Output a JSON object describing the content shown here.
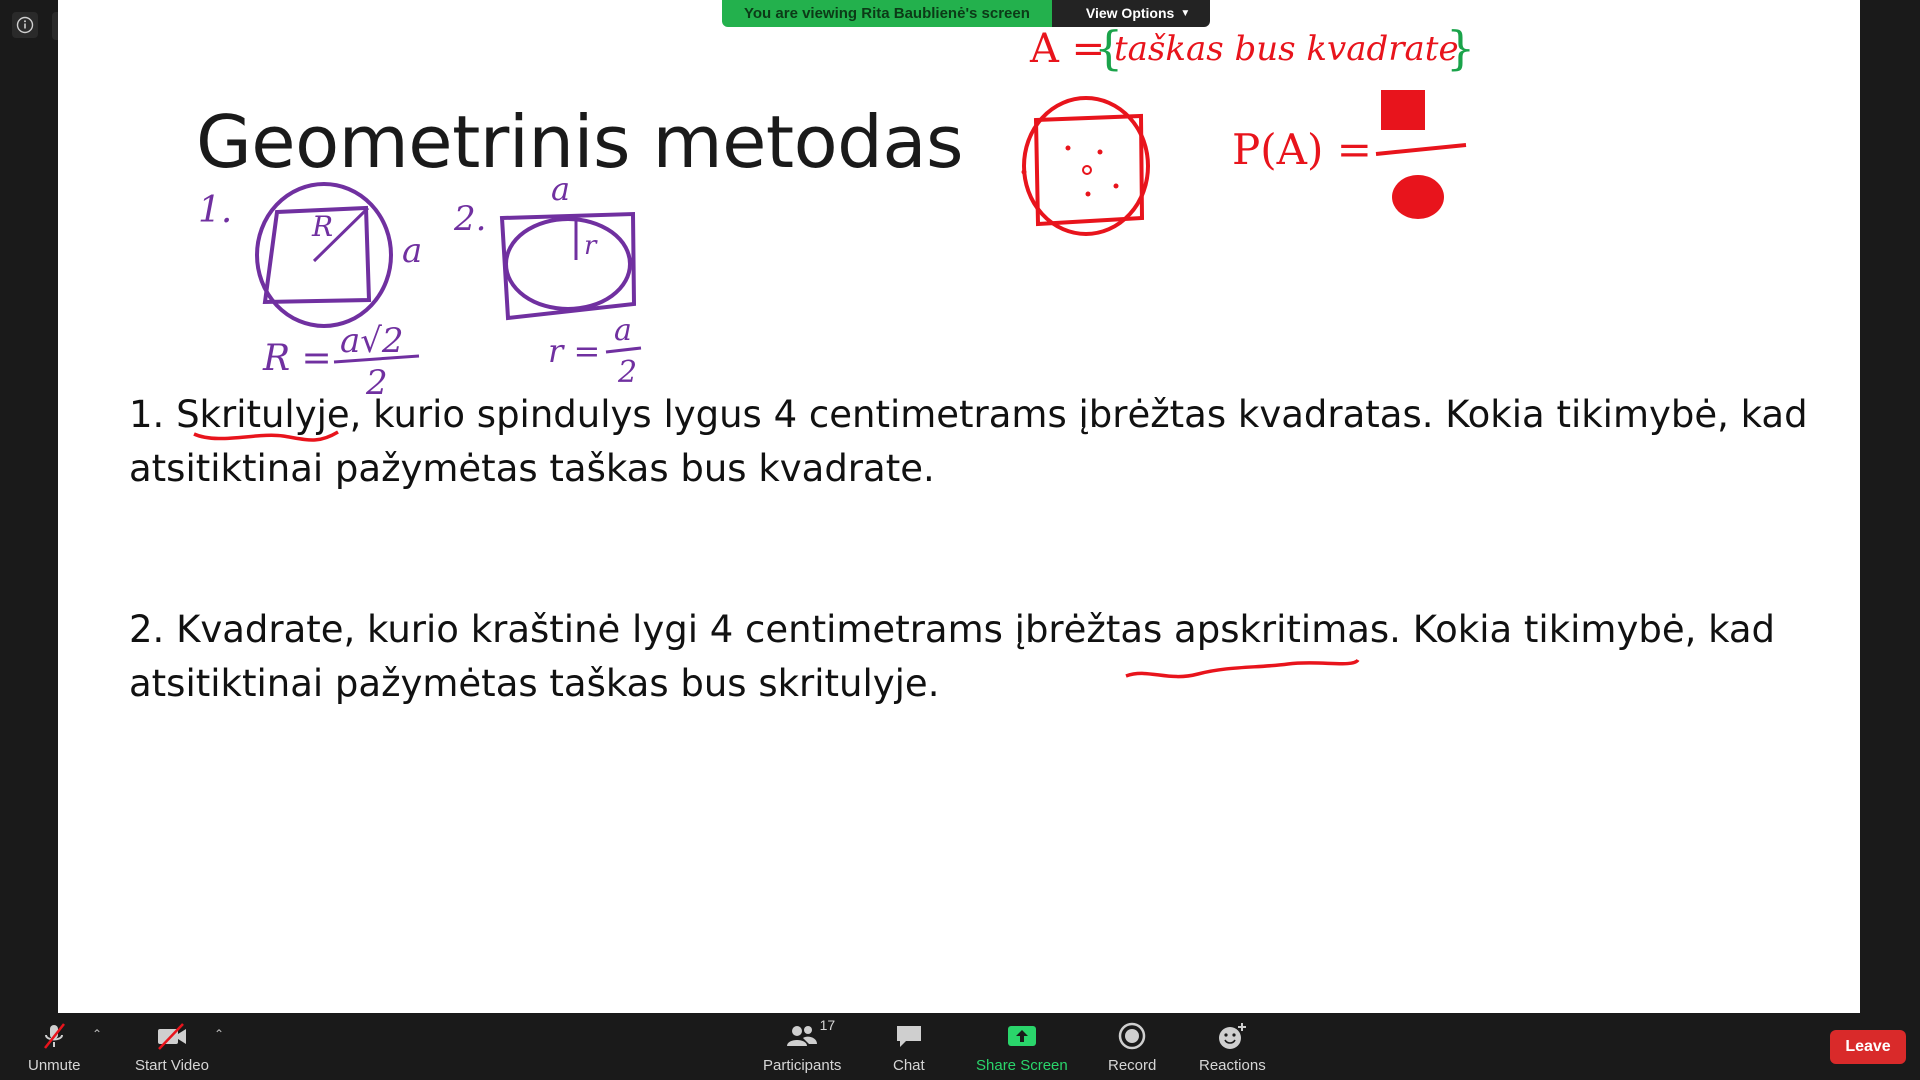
{
  "banner": {
    "viewing_text": "You are viewing Rita Baublienė's screen",
    "view_options": "View Options"
  },
  "slide": {
    "title": "Geometrinis metodas",
    "problem1": "1. Skritulyje, kurio spindulys lygus 4 centimetrams įbrėžtas kvadratas. Kokia tikimybė, kad atsitiktinai pažymėtas taškas bus kvadrate.",
    "problem2": "2. Kvadrate, kurio kraštinė lygi 4 centimetrams įbrėžtas apskritimas. Kokia tikimybė, kad atsitiktinai pažymėtas taškas bus skritulyje."
  },
  "annotations": {
    "label1": "1.",
    "label2": "2.",
    "R_label": "R",
    "a_side": "a",
    "a_top": "a",
    "r_label": "r",
    "formula1_lhs": "R =",
    "formula1_num": "a√2",
    "formula1_den": "2",
    "formula2_lhs": "r =",
    "formula2_num": "a",
    "formula2_den": "2",
    "event_A": "A =",
    "event_text": "taškas bus kvadrate",
    "prob": "P(A) ="
  },
  "toolbar": {
    "unmute": "Unmute",
    "start_video": "Start Video",
    "participants": "Participants",
    "participants_count": "17",
    "chat": "Chat",
    "share_screen": "Share Screen",
    "record": "Record",
    "reactions": "Reactions",
    "leave": "Leave"
  },
  "colors": {
    "banner_green": "#23b14d",
    "share_green": "#2ad56b",
    "leave_red": "#d92a2a",
    "ink_purple": "#7030a0",
    "ink_red": "#e8141c",
    "ink_green": "#1aa34a"
  }
}
